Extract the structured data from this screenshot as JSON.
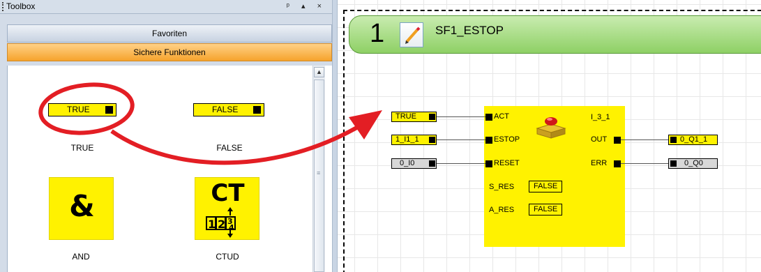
{
  "toolbox": {
    "title": "Toolbox",
    "controls": [
      "ᵖ",
      "▴",
      "×"
    ],
    "categories": {
      "favorites": "Favoriten",
      "safe_functions": "Sichere Funktionen"
    },
    "items": [
      {
        "block_text": "TRUE",
        "label": "TRUE"
      },
      {
        "block_text": "FALSE",
        "label": "FALSE"
      },
      {
        "block_text": "&",
        "label": "AND"
      },
      {
        "block_text": "CT",
        "label": "CTUD"
      }
    ]
  },
  "network": {
    "number": "1",
    "title": "SF1_ESTOP",
    "function_block": {
      "instance": "I_3_1",
      "inputs": [
        "ACT",
        "ESTOP",
        "RESET"
      ],
      "outputs": [
        "OUT",
        "ERR"
      ],
      "params": [
        {
          "name": "S_RES",
          "value": "FALSE"
        },
        {
          "name": "A_RES",
          "value": "FALSE"
        }
      ]
    },
    "input_vars": [
      "TRUE",
      "1_I1_1",
      "0_I0"
    ],
    "output_vars": [
      "0_Q1_1",
      "0_Q0"
    ]
  },
  "colors": {
    "block_yellow": "#fff200",
    "header_green": "#8ed065",
    "category_orange": "#f6a32c",
    "annotation_red": "#e31e24"
  }
}
